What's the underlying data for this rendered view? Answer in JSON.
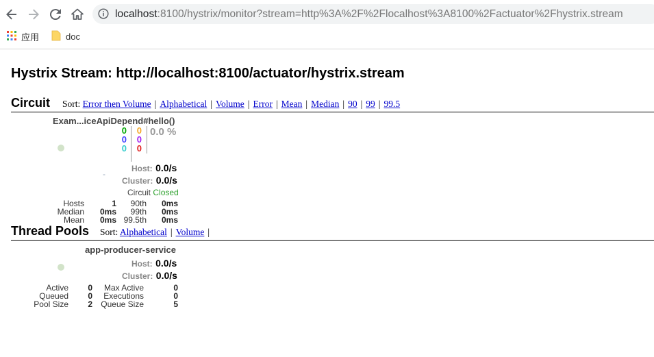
{
  "browser": {
    "url_host": "localhost",
    "url_rest": ":8100/hystrix/monitor?stream=http%3A%2F%2Flocalhost%3A8100%2Factuator%2Fhystrix.stream",
    "bookmarks": [
      {
        "label": "应用",
        "icon": "apps-grid-icon"
      },
      {
        "label": "doc",
        "icon": "folder-icon"
      }
    ]
  },
  "page": {
    "title": "Hystrix Stream: http://localhost:8100/actuator/hystrix.stream"
  },
  "circuit": {
    "heading": "Circuit",
    "sort_label": "Sort:",
    "sort_options": [
      "Error then Volume",
      "Alphabetical",
      "Volume",
      "Error",
      "Mean",
      "Median",
      "90",
      "99",
      "99.5"
    ],
    "card": {
      "name": "Exam...iceApiDepend#hello()",
      "counts_left": [
        "0",
        "0",
        "0"
      ],
      "counts_right": [
        "0",
        "0",
        "0"
      ],
      "colors_left": [
        "#00a800",
        "#4040ff",
        "#33cccc"
      ],
      "colors_right": [
        "#f5a623",
        "#a020f0",
        "#e02020"
      ],
      "error_pct": "0.0 %",
      "dash": "-",
      "host_label": "Host:",
      "host_value": "0.0/s",
      "cluster_label": "Cluster:",
      "cluster_value": "0.0/s",
      "circuit_label": "Circuit",
      "circuit_status": "Closed",
      "stats": {
        "col1_labels": [
          "Hosts",
          "Median",
          "Mean"
        ],
        "col1_values": [
          "1",
          "0ms",
          "0ms"
        ],
        "col2_labels": [
          "90th",
          "99th",
          "99.5th"
        ],
        "col2_values": [
          "0ms",
          "0ms",
          "0ms"
        ]
      }
    }
  },
  "thread_pools": {
    "heading": "Thread Pools",
    "sort_label": "Sort:",
    "sort_options": [
      "Alphabetical",
      "Volume"
    ],
    "card": {
      "name": "app-producer-service",
      "host_label": "Host:",
      "host_value": "0.0/s",
      "cluster_label": "Cluster:",
      "cluster_value": "0.0/s",
      "stats": {
        "col1_labels": [
          "Active",
          "Queued",
          "Pool Size"
        ],
        "col1_values": [
          "0",
          "0",
          "2"
        ],
        "col2_labels": [
          "Max Active",
          "Executions",
          "Queue Size"
        ],
        "col2_values": [
          "0",
          "0",
          "5"
        ]
      }
    }
  }
}
